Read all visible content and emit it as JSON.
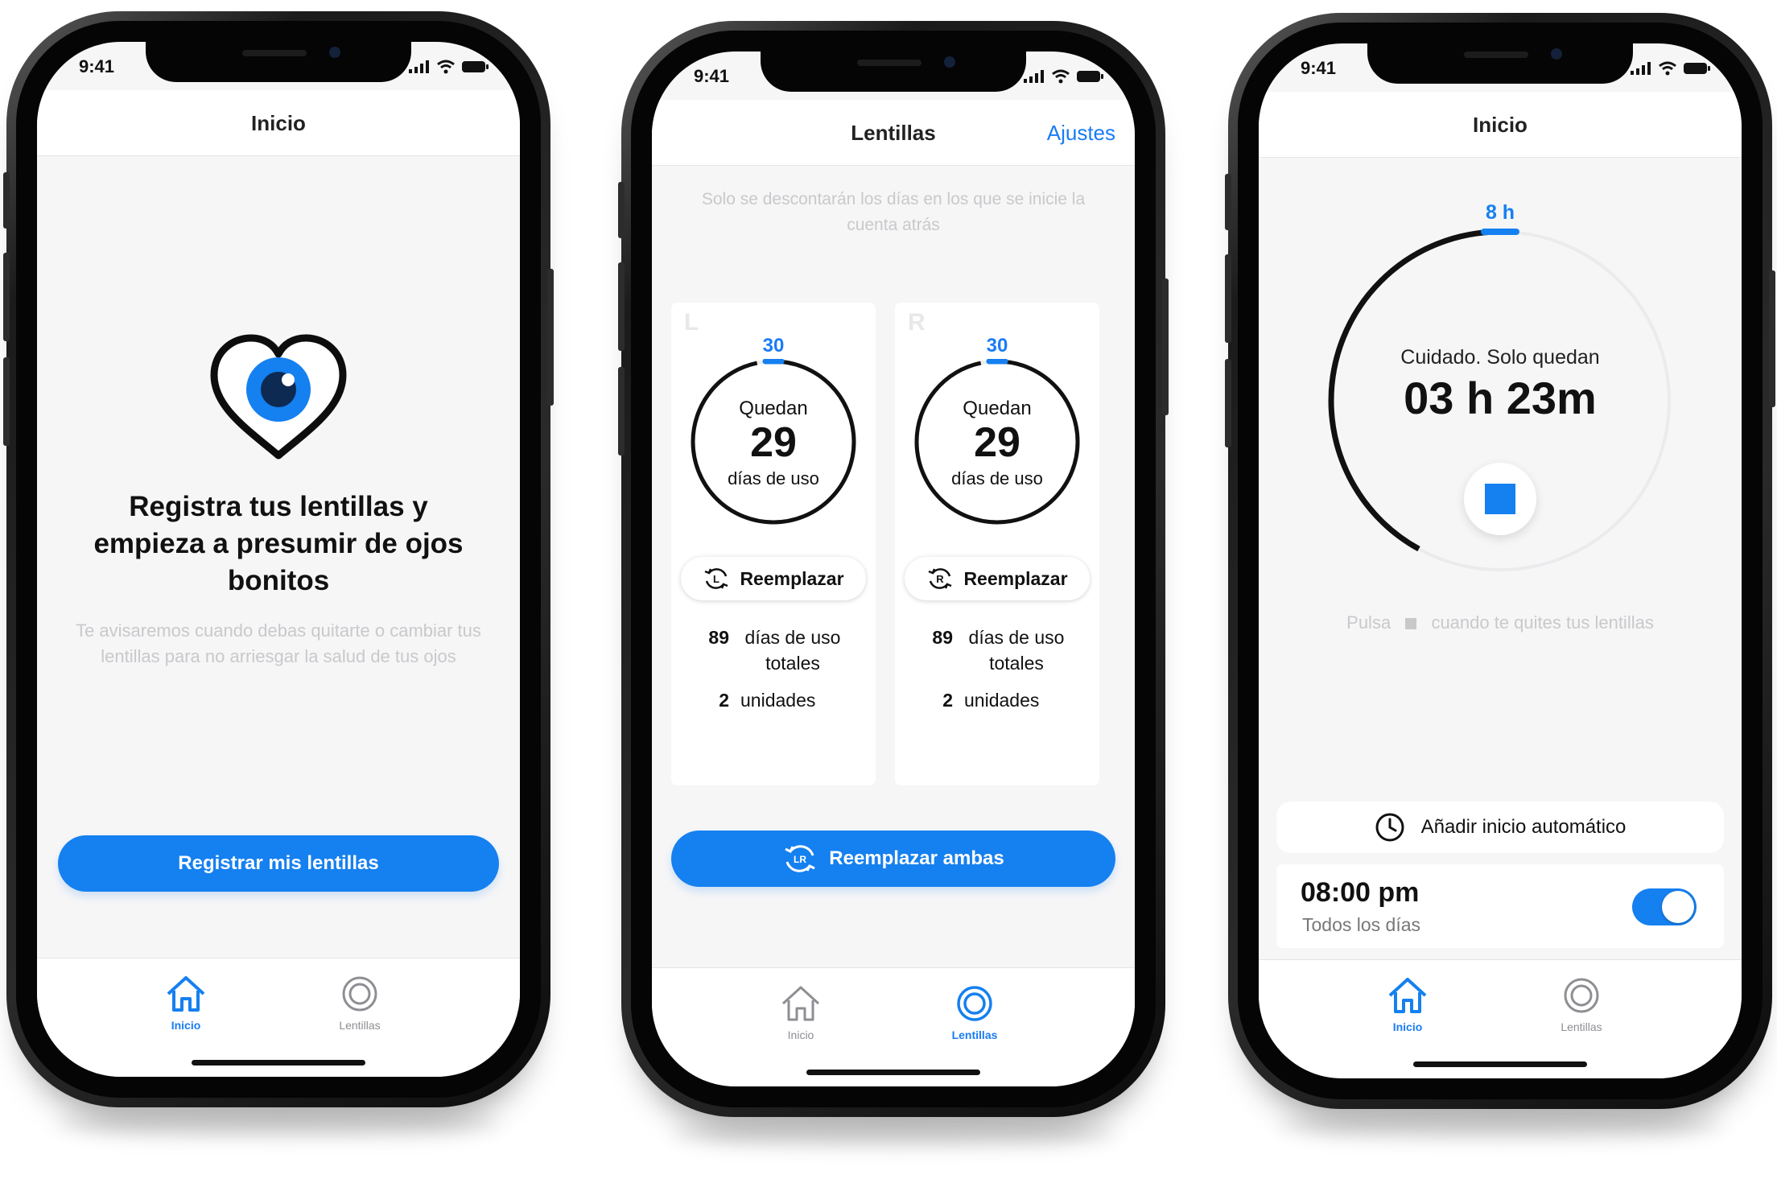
{
  "colors": {
    "accent": "#1580f0",
    "ring": "#111111",
    "hint": "#c9c9cc",
    "background": "#f6f6f7"
  },
  "phone1": {
    "status_time": "9:41",
    "title": "Inicio",
    "heading": "Registra tus lentillas y empieza  a presumir de ojos bonitos",
    "hint": "Te avisaremos cuando debas quitarte o cambiar tus lentillas para no arriesgar la salud de tus ojos",
    "button": "Registrar mis lentillas",
    "tabs": [
      {
        "label": "Inicio",
        "icon": "home-icon",
        "active": true
      },
      {
        "label": "Lentillas",
        "icon": "lens-icon",
        "active": false
      }
    ]
  },
  "phone2": {
    "status_time": "9:41",
    "title": "Lentillas",
    "action": "Ajustes",
    "hint": "Solo se descontarán los días en los que se inicie la cuenta atrás",
    "cards": [
      {
        "side": "L",
        "total": "30",
        "remaining_label": "Quedan",
        "remaining": "29",
        "unit": "días de uso",
        "progress": 0.967,
        "button": "Reemplazar",
        "button_icon": "L",
        "usage_count": "89",
        "usage_label": "días de uso totales",
        "units_count": "2",
        "units_label": "unidades"
      },
      {
        "side": "R",
        "total": "30",
        "remaining_label": "Quedan",
        "remaining": "29",
        "unit": "días de uso",
        "progress": 0.967,
        "button": "Reemplazar",
        "button_icon": "R",
        "usage_count": "89",
        "usage_label": "días de uso totales",
        "units_count": "2",
        "units_label": "unidades"
      }
    ],
    "button": "Reemplazar ambas",
    "button_icon": "LR",
    "tabs": [
      {
        "label": "Inicio",
        "icon": "home-icon",
        "active": false
      },
      {
        "label": "Lentillas",
        "icon": "lens-icon",
        "active": true
      }
    ]
  },
  "phone3": {
    "status_time": "9:41",
    "title": "Inicio",
    "max_label": "8 h",
    "warning": "Cuidado. Solo quedan",
    "remaining": "03 h 23m",
    "progress": 0.42,
    "hint_before": "Pulsa",
    "hint_after": "cuando te quites tus lentillas",
    "auto_button": "Añadir inicio automático",
    "alarm_time": "08:00 pm",
    "alarm_repeat": "Todos los días",
    "alarm_enabled": true,
    "tabs": [
      {
        "label": "Inicio",
        "icon": "home-icon",
        "active": true
      },
      {
        "label": "Lentillas",
        "icon": "lens-icon",
        "active": false
      }
    ]
  }
}
